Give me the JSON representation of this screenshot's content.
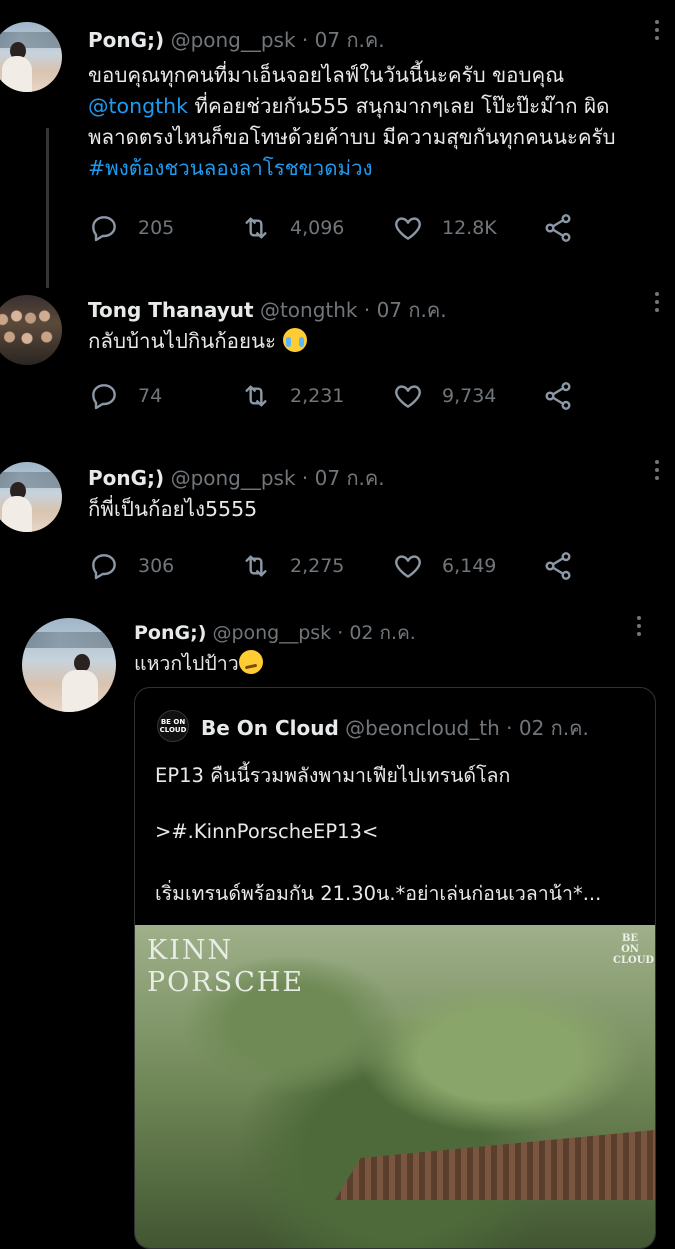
{
  "tweets": [
    {
      "name": "PonG;)",
      "handle": "@pong__psk",
      "date": "· 07 ก.ค.",
      "lines": [
        "ขอบคุณทุกคนที่มาเอ็นจอยไลฟ์ในวันนี้นะครับ ขอบคุณ",
        "ที่คอยช่วยกัน555 สนุกมากๆเลย โป๊ะป๊ะม๊าก ผิด",
        "พลาดตรงไหนก็ขอโทษด้วยค้าบบ มีความสุขกันทุกคนนะครับ"
      ],
      "mention": "@tongthk",
      "hashtag": "#พงต้องชวนลองลาโรชขวดม่วง",
      "stats": {
        "replies": "205",
        "retweets": "4,096",
        "likes": "12.8K"
      }
    },
    {
      "name": "Tong Thanayut",
      "handle": "@tongthk",
      "date": "· 07 ก.ค.",
      "text": "กลับบ้านไปกินก้อยนะ",
      "emoji": "face-with-tears-of-joy",
      "stats": {
        "replies": "74",
        "retweets": "2,231",
        "likes": "9,734"
      }
    },
    {
      "name": "PonG;)",
      "handle": "@pong__psk",
      "date": "· 07 ก.ค.",
      "text": "ก็พี่เป็นก้อยไง5555",
      "stats": {
        "replies": "306",
        "retweets": "2,275",
        "likes": "6,149"
      }
    },
    {
      "name": "PonG;)",
      "handle": "@pong__psk",
      "date": "· 02 ก.ค.",
      "text": "แหวกไปป้าว",
      "emoji": "smirking-face"
    }
  ],
  "quote": {
    "logo_text": "BE ON CLOUD",
    "name": "Be On Cloud",
    "handle": "@beoncloud_th",
    "date": "· 02 ก.ค.",
    "line1": "EP13 คืนนี้รวมพลังพามาเฟียไปเทรนด์โลก",
    "line2": ">#.KinnPorscheEP13<",
    "line3": "เริ่มเทรนด์พร้อมกัน 21.30น.*อย่าเล่นก่อนเวลาน้า*...",
    "image_title_1": "KINN",
    "image_title_2": "PORSCHE",
    "image_badge": "BE ON CLOUD"
  },
  "colors": {
    "background": "#000000",
    "text": "#e7e9ea",
    "muted": "#71767b",
    "link": "#1d9bf0"
  },
  "icons": [
    "reply-icon",
    "retweet-icon",
    "like-icon",
    "share-icon",
    "more-icon"
  ]
}
